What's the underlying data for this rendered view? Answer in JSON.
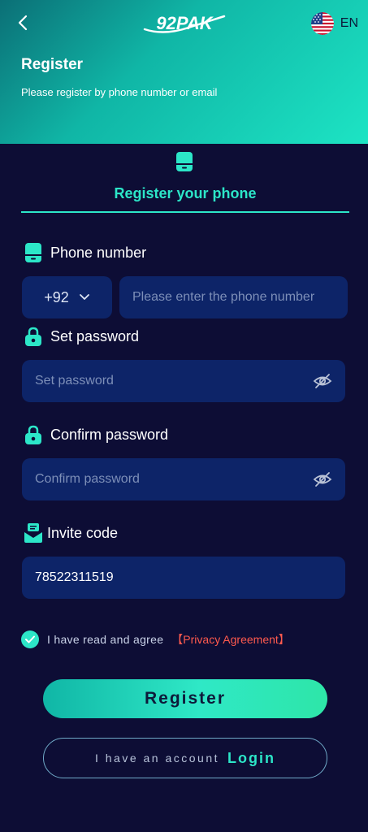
{
  "header": {
    "logo_text": "92PAK",
    "language": "EN",
    "title": "Register",
    "subtitle": "Please register by phone number or email"
  },
  "tab": {
    "label": "Register your phone"
  },
  "form": {
    "phone": {
      "label": "Phone number",
      "country_code": "+92",
      "placeholder": "Please enter the phone number"
    },
    "password": {
      "label": "Set password",
      "placeholder": "Set password"
    },
    "confirm": {
      "label": "Confirm password",
      "placeholder": "Confirm password"
    },
    "invite": {
      "label": "Invite code",
      "value": "78522311519"
    }
  },
  "agreement": {
    "checked": true,
    "text": "I have read and agree",
    "link": "【Privacy Agreement】"
  },
  "buttons": {
    "register": "Register",
    "login_prefix": "I have an account",
    "login": "Login"
  },
  "colors": {
    "accent": "#2ce6c8",
    "background": "#0d0d35",
    "input_bg": "#0d2468",
    "link_red": "#ff5a4e"
  },
  "icons": [
    "back-arrow-icon",
    "us-flag-icon",
    "phone-icon",
    "lock-icon",
    "invite-icon",
    "eye-off-icon",
    "check-icon",
    "chevron-down-icon"
  ]
}
